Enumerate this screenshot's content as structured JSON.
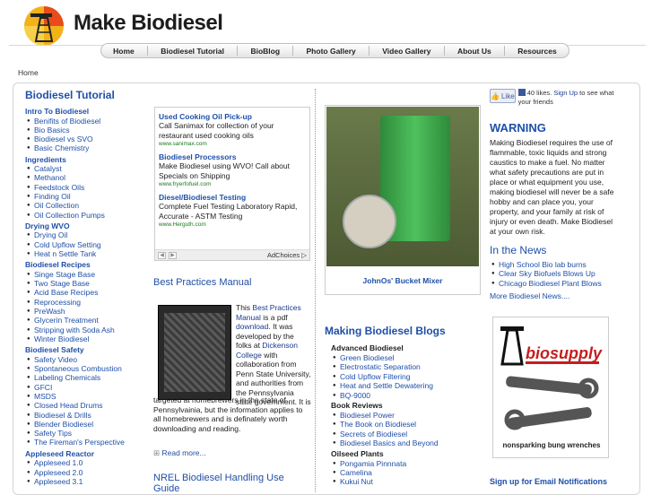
{
  "site": {
    "title": "Make Biodiesel"
  },
  "nav": {
    "items": [
      "Home",
      "Biodiesel Tutorial",
      "BioBlog",
      "Photo Gallery",
      "Video Gallery",
      "About Us",
      "Resources"
    ]
  },
  "breadcrumb": "Home",
  "tutorial": {
    "title": "Biodiesel Tutorial",
    "sections": [
      {
        "label": "Intro To Biodiesel",
        "items": [
          "Benifits of Biodiesel",
          "Bio Basics",
          "Biodiesel vs SVO",
          "Basic Chemistry"
        ]
      },
      {
        "label": "Ingredients",
        "items": [
          "Catalyst",
          "Methanol",
          "Feedstock Oils",
          "Finding Oil",
          "Oil Collection",
          "Oil Collection Pumps"
        ]
      },
      {
        "label": "Drying WVO",
        "items": [
          "Drying Oil",
          "Cold Upflow Setting",
          "Heat n Settle Tank"
        ]
      },
      {
        "label": "Biodiesel Recipes",
        "items": [
          "Singe Stage Base",
          "Two Stage Base",
          "Acid Base Recipes",
          "Reprocessing",
          "PreWash",
          "Glycerin Treatment",
          "Stripping with Soda Ash",
          "Winter Biodiesel"
        ]
      },
      {
        "label": "Biodiesel Safety",
        "items": [
          "Safety Video",
          "Spontaneous Combustion",
          "Labeling Chemicals",
          "GFCI",
          "MSDS",
          "Closed Head Drums",
          "Biodiesel & Drills",
          "Blender Biodiesel",
          "Safety Tips",
          "The Fireman's Perspective"
        ]
      },
      {
        "label": "Appleseed Reactor",
        "items": [
          "Appleseed 1.0",
          "Appleseed 2.0",
          "Appleseed 3.1"
        ]
      }
    ]
  },
  "ads": [
    {
      "title": "Used Cooking Oil Pick-up",
      "desc": "Call Sanimax for collection of your restaurant used cooking oils",
      "url": "www.sanimax.com"
    },
    {
      "title": "Biodiesel Processors",
      "desc": "Make Biodiesel using WVO! Call about Specials on Shipping",
      "url": "www.fryerfofuel.com"
    },
    {
      "title": "Diesel/Biodiesel Testing",
      "desc": "Complete Fuel Testing Laboratory Rapid, Accurate - ASTM Testing",
      "url": "www.Herguth.com"
    }
  ],
  "adchoices": "AdChoices ▷",
  "best_practices": {
    "title": "Best Practices Manual",
    "text_a": "This ",
    "link1": "Best Practices Manual",
    "text_b": " is a pdf ",
    "link2": "download",
    "text_c": ". It was developed by the folks at ",
    "link3": "Dickenson College",
    "text_d": " with collaboration from Penn State University, and authorities from the Pennsylvania state government. It is",
    "text_e": "targeted at homebrewers in the state of Pennsylvainia, but the information applies to all homebrewers and is definately worth downloading and reading.",
    "readmore": "Read more..."
  },
  "nrel_title": "NREL Biodiesel Handling Use Guide",
  "photo": {
    "caption": "JohnOs' Bucket Mixer"
  },
  "blogs": {
    "title": "Making Biodiesel Blogs",
    "groups": [
      {
        "label": "Advanced Biodiesel",
        "items": [
          "Green Biodiesel",
          "Electrostatic Separation",
          "Cold Upflow Filtering",
          "Heat and Settle Dewatering",
          "BQ-9000"
        ]
      },
      {
        "label": "Book Reviews",
        "items": [
          "Biodiesel Power",
          "The Book on Biodiesel",
          "Secrets of Biodiesel",
          "Biodiesel Basics and Beyond"
        ]
      },
      {
        "label": "Oilseed Plants",
        "items": [
          "Pongamia Pinnnata",
          "Camelina",
          "Kukui Nut"
        ]
      }
    ]
  },
  "facebook": {
    "like": "Like",
    "text_a": "40 likes. ",
    "signup": "Sign Up",
    "text_b": " to see what your friends"
  },
  "warning": {
    "title": "WARNING",
    "text": "Making Biodiesel requires the use of flammable, toxic liquids and strong caustics to make a fuel. No matter what safety precautions are put in place or what equipment you use, making biodiesel will never be a safe hobby and can place you, your property, and your family at risk of injury or even death. Make Biodiesel at your own risk."
  },
  "news": {
    "title": "In the News",
    "items": [
      "High School Bio lab burns",
      "Clear Sky Biofuels Blows Up",
      "Chicago Biodiesel Plant Blows"
    ],
    "more": "More Biodiesel News...."
  },
  "promo": {
    "brand": "biosupply",
    "caption": "nonsparking bung wrenches"
  },
  "email_signup": "Sign up for Email Notifications",
  "colors": {
    "accent": "#1e4fa8",
    "title": "#1d1d1d"
  }
}
